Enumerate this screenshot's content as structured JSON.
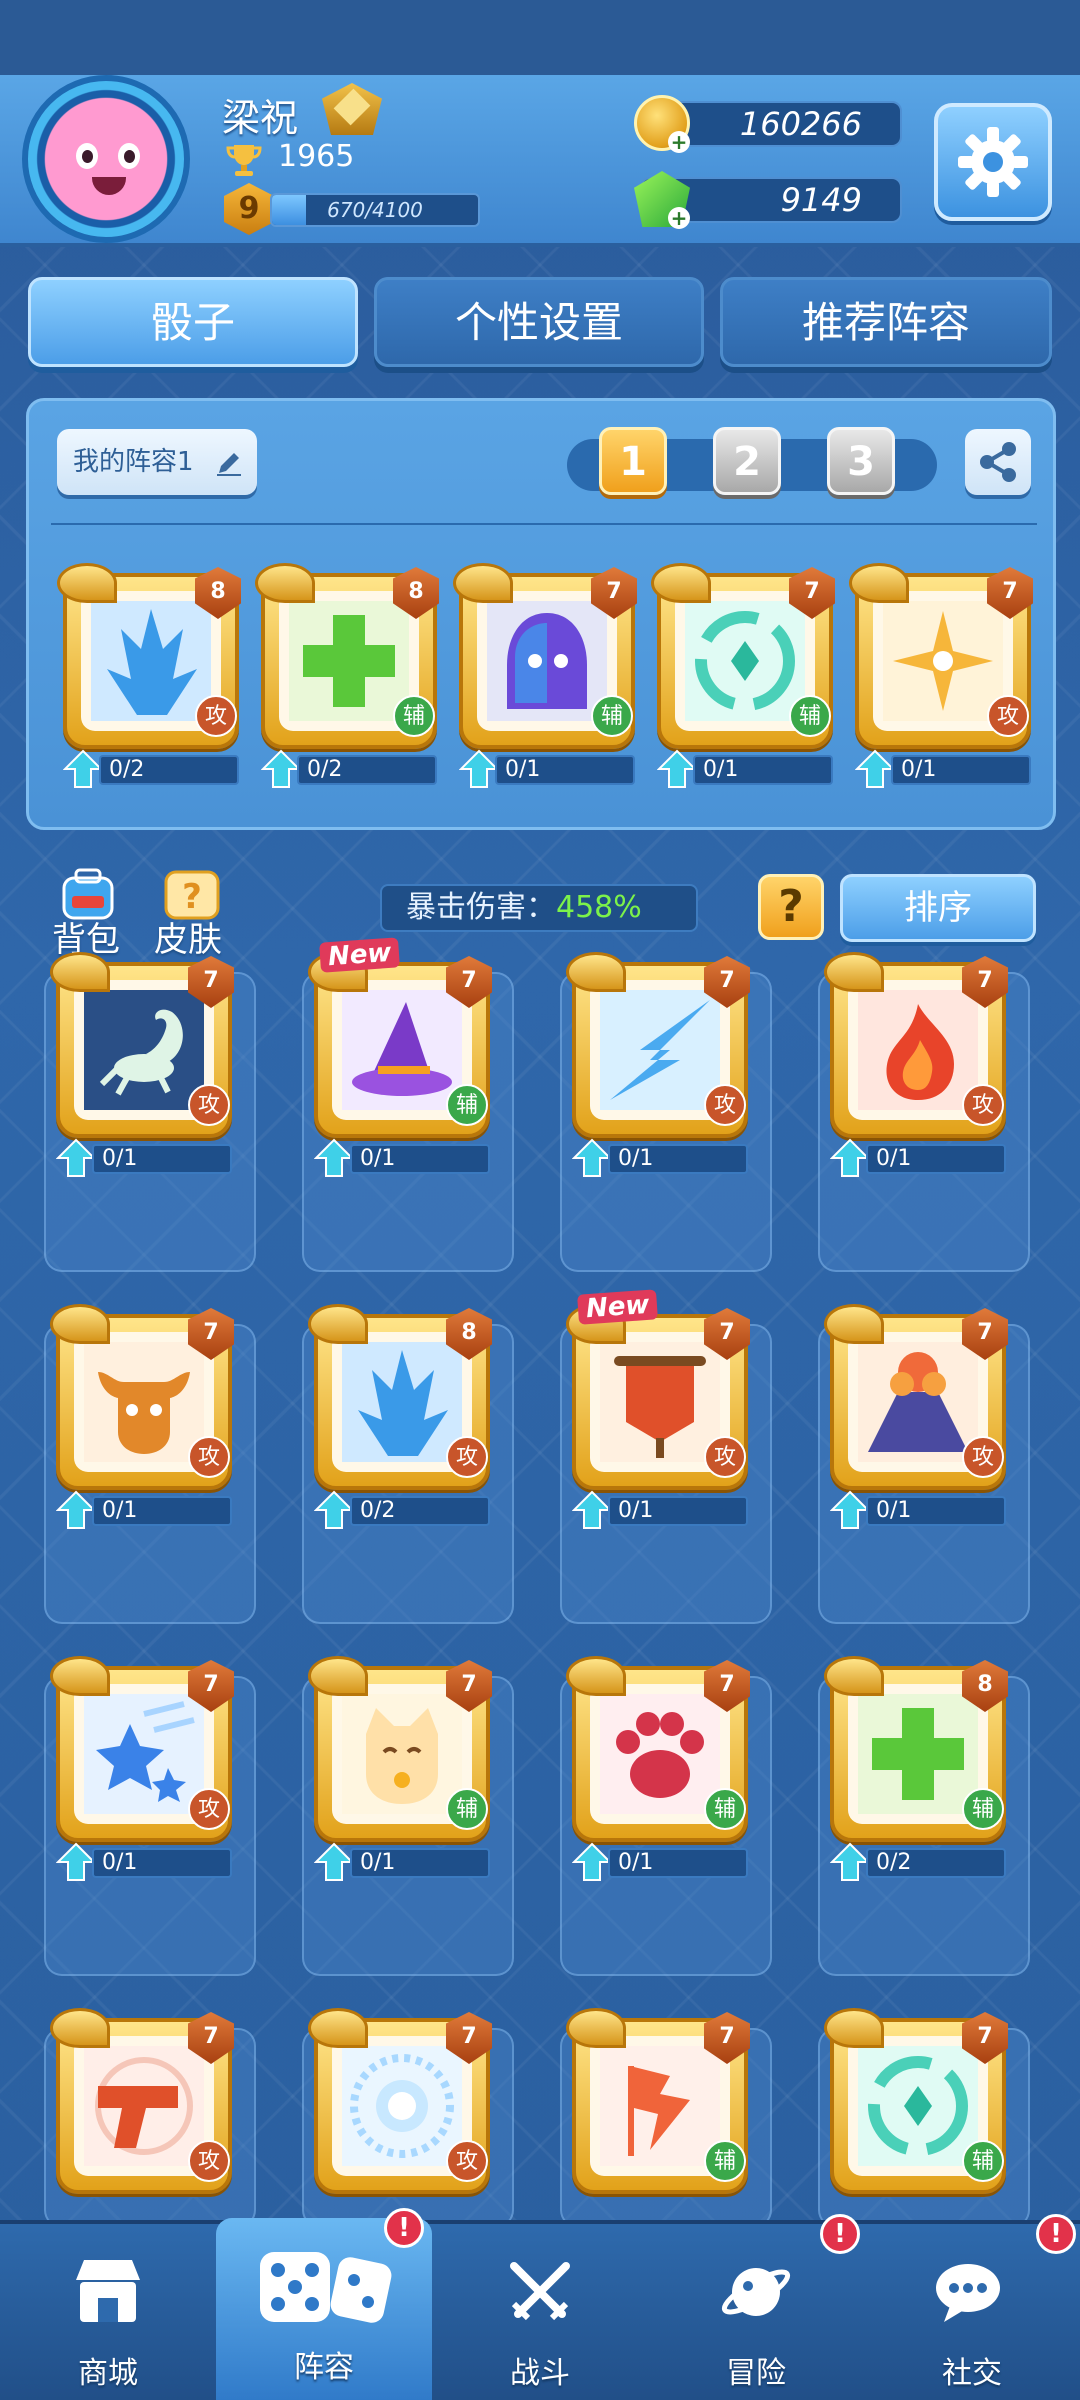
{
  "player": {
    "name": "梁祝",
    "trophies": "1965",
    "level": "9",
    "xp_text": "670/4100",
    "xp_fraction": 0.163
  },
  "currency": {
    "coins": "160266",
    "gems": "9149"
  },
  "tabs": [
    {
      "label": "骰子",
      "active": true
    },
    {
      "label": "个性设置",
      "active": false
    },
    {
      "label": "推荐阵容",
      "active": false
    }
  ],
  "deck": {
    "name": "我的阵容1",
    "slots": [
      "1",
      "2",
      "3"
    ],
    "active_slot": "1",
    "cards": [
      {
        "icon": "ice-spikes-icon",
        "level": "8",
        "type": "攻",
        "progress": "0/2"
      },
      {
        "icon": "green-cross-icon",
        "level": "8",
        "type": "辅",
        "progress": "0/2"
      },
      {
        "icon": "hooded-mask-icon",
        "level": "7",
        "type": "辅",
        "progress": "0/1"
      },
      {
        "icon": "teal-vortex-icon",
        "level": "7",
        "type": "辅",
        "progress": "0/1"
      },
      {
        "icon": "star-sparkle-icon",
        "level": "7",
        "type": "攻",
        "progress": "0/1"
      }
    ]
  },
  "middle": {
    "bag_label": "背包",
    "skin_label": "皮肤",
    "crit_label": "暴击伤害：",
    "crit_value": "458%",
    "help_label": "?",
    "sort_label": "排序"
  },
  "collection": [
    {
      "icon": "scorpion-icon",
      "level": "7",
      "type": "攻",
      "progress": "0/1",
      "new": ""
    },
    {
      "icon": "wizard-hat-icon",
      "level": "7",
      "type": "辅",
      "progress": "0/1",
      "new": "New"
    },
    {
      "icon": "lightning-icon",
      "level": "7",
      "type": "攻",
      "progress": "0/1",
      "new": ""
    },
    {
      "icon": "fire-icon",
      "level": "7",
      "type": "攻",
      "progress": "0/1",
      "new": ""
    },
    {
      "icon": "ox-head-icon",
      "level": "7",
      "type": "攻",
      "progress": "0/1",
      "new": ""
    },
    {
      "icon": "ice-spikes-icon",
      "level": "8",
      "type": "攻",
      "progress": "0/2",
      "new": ""
    },
    {
      "icon": "war-banner-icon",
      "level": "7",
      "type": "攻",
      "progress": "0/1",
      "new": "New"
    },
    {
      "icon": "volcano-icon",
      "level": "7",
      "type": "攻",
      "progress": "0/1",
      "new": ""
    },
    {
      "icon": "shooting-star-icon",
      "level": "7",
      "type": "攻",
      "progress": "0/1",
      "new": ""
    },
    {
      "icon": "lucky-cat-icon",
      "level": "7",
      "type": "辅",
      "progress": "0/1",
      "new": ""
    },
    {
      "icon": "paw-print-icon",
      "level": "7",
      "type": "辅",
      "progress": "0/1",
      "new": ""
    },
    {
      "icon": "green-cross-icon",
      "level": "8",
      "type": "辅",
      "progress": "0/2",
      "new": ""
    },
    {
      "icon": "pistol-icon",
      "level": "7",
      "type": "攻",
      "progress": "",
      "new": ""
    },
    {
      "icon": "sun-burst-icon",
      "level": "7",
      "type": "攻",
      "progress": "",
      "new": ""
    },
    {
      "icon": "flame-flag-icon",
      "level": "7",
      "type": "辅",
      "progress": "",
      "new": ""
    },
    {
      "icon": "teal-vortex-icon",
      "level": "7",
      "type": "辅",
      "progress": "",
      "new": ""
    }
  ],
  "nav": [
    {
      "label": "商城",
      "icon": "shop-icon",
      "alert": ""
    },
    {
      "label": "阵容",
      "icon": "dice-icon",
      "alert": "!"
    },
    {
      "label": "战斗",
      "icon": "crossed-swords-icon",
      "alert": ""
    },
    {
      "label": "冒险",
      "icon": "planet-icon",
      "alert": "!"
    },
    {
      "label": "社交",
      "icon": "chat-icon",
      "alert": "!"
    }
  ],
  "colors": {
    "active_tab": "#4c9ee8",
    "attack_badge": "#c8552a",
    "support_badge": "#3aa84a",
    "crit_value": "#7cf24a",
    "alert": "#e2324a"
  }
}
